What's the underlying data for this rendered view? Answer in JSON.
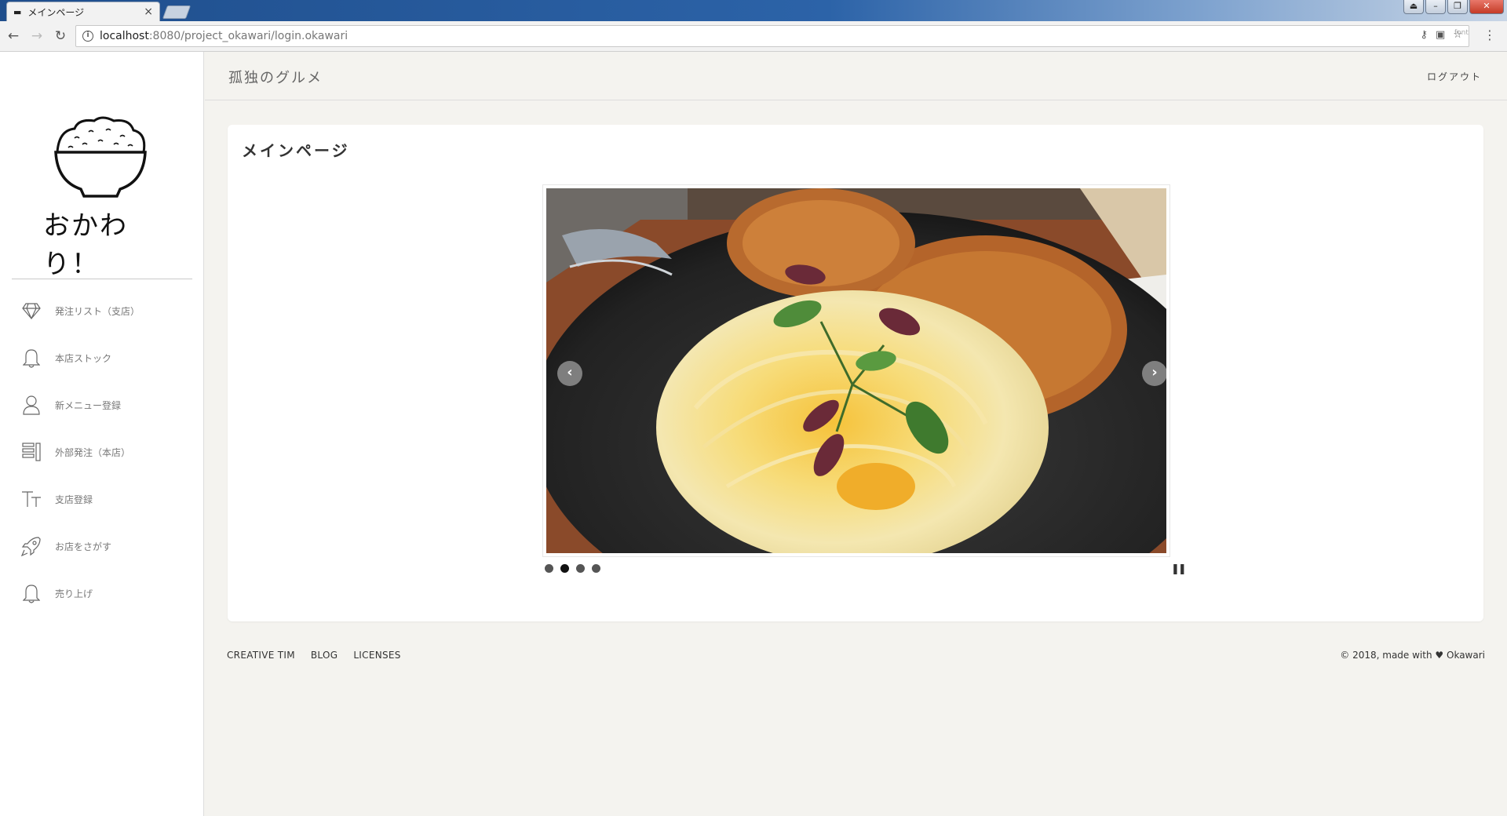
{
  "browser": {
    "tab_title": "メインページ",
    "tab_close": "×",
    "url_host": "localhost",
    "url_rest": ":8080/project_okawari/login.okawari",
    "ext_label": "font"
  },
  "sidebar": {
    "logo_text": "おかわり！",
    "items": [
      {
        "label": "発注リスト（支店）",
        "icon": "diamond-icon"
      },
      {
        "label": "本店ストック",
        "icon": "bell-icon"
      },
      {
        "label": "新メニュー登録",
        "icon": "user-icon"
      },
      {
        "label": "外部発注（本店）",
        "icon": "list-icon"
      },
      {
        "label": "支店登録",
        "icon": "text-icon"
      },
      {
        "label": "お店をさがす",
        "icon": "rocket-icon"
      },
      {
        "label": "売り上げ",
        "icon": "bell-icon"
      }
    ]
  },
  "header": {
    "brand": "孤独のグルメ",
    "logout": "ログアウト"
  },
  "main": {
    "title": "メインページ",
    "carousel": {
      "slide_count": 4,
      "active_index": 1
    }
  },
  "footer": {
    "links": [
      "CREATIVE TIM",
      "BLOG",
      "LICENSES"
    ],
    "copyright_prefix": "© 2018, made with",
    "copyright_suffix": "Okawari"
  }
}
